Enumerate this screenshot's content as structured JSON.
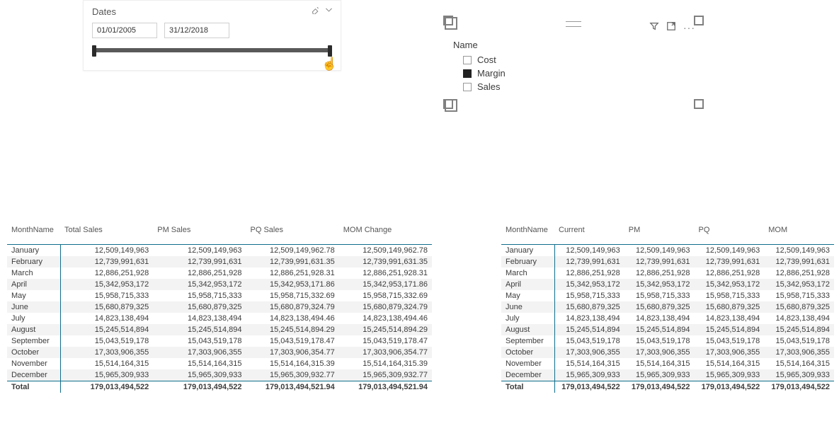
{
  "dates_slicer": {
    "title": "Dates",
    "from": "01/01/2005",
    "to": "31/12/2018"
  },
  "name_slicer": {
    "title": "Name",
    "items": [
      {
        "label": "Cost",
        "checked": false
      },
      {
        "label": "Margin",
        "checked": true
      },
      {
        "label": "Sales",
        "checked": false
      }
    ]
  },
  "table_left": {
    "headers": [
      "MonthName",
      "Total Sales",
      "PM Sales",
      "PQ Sales",
      "MOM Change"
    ],
    "rows": [
      [
        "January",
        "12,509,149,963",
        "12,509,149,963",
        "12,509,149,962.78",
        "12,509,149,962.78"
      ],
      [
        "February",
        "12,739,991,631",
        "12,739,991,631",
        "12,739,991,631.35",
        "12,739,991,631.35"
      ],
      [
        "March",
        "12,886,251,928",
        "12,886,251,928",
        "12,886,251,928.31",
        "12,886,251,928.31"
      ],
      [
        "April",
        "15,342,953,172",
        "15,342,953,172",
        "15,342,953,171.86",
        "15,342,953,171.86"
      ],
      [
        "May",
        "15,958,715,333",
        "15,958,715,333",
        "15,958,715,332.69",
        "15,958,715,332.69"
      ],
      [
        "June",
        "15,680,879,325",
        "15,680,879,325",
        "15,680,879,324.79",
        "15,680,879,324.79"
      ],
      [
        "July",
        "14,823,138,494",
        "14,823,138,494",
        "14,823,138,494.46",
        "14,823,138,494.46"
      ],
      [
        "August",
        "15,245,514,894",
        "15,245,514,894",
        "15,245,514,894.29",
        "15,245,514,894.29"
      ],
      [
        "September",
        "15,043,519,178",
        "15,043,519,178",
        "15,043,519,178.47",
        "15,043,519,178.47"
      ],
      [
        "October",
        "17,303,906,355",
        "17,303,906,355",
        "17,303,906,354.77",
        "17,303,906,354.77"
      ],
      [
        "November",
        "15,514,164,315",
        "15,514,164,315",
        "15,514,164,315.39",
        "15,514,164,315.39"
      ],
      [
        "December",
        "15,965,309,933",
        "15,965,309,933",
        "15,965,309,932.77",
        "15,965,309,932.77"
      ]
    ],
    "total": [
      "Total",
      "179,013,494,522",
      "179,013,494,522",
      "179,013,494,521.94",
      "179,013,494,521.94"
    ]
  },
  "table_right": {
    "headers": [
      "MonthName",
      "Current",
      "PM",
      "PQ",
      "MOM"
    ],
    "rows": [
      [
        "January",
        "12,509,149,963",
        "12,509,149,963",
        "12,509,149,963",
        "12,509,149,963"
      ],
      [
        "February",
        "12,739,991,631",
        "12,739,991,631",
        "12,739,991,631",
        "12,739,991,631"
      ],
      [
        "March",
        "12,886,251,928",
        "12,886,251,928",
        "12,886,251,928",
        "12,886,251,928"
      ],
      [
        "April",
        "15,342,953,172",
        "15,342,953,172",
        "15,342,953,172",
        "15,342,953,172"
      ],
      [
        "May",
        "15,958,715,333",
        "15,958,715,333",
        "15,958,715,333",
        "15,958,715,333"
      ],
      [
        "June",
        "15,680,879,325",
        "15,680,879,325",
        "15,680,879,325",
        "15,680,879,325"
      ],
      [
        "July",
        "14,823,138,494",
        "14,823,138,494",
        "14,823,138,494",
        "14,823,138,494"
      ],
      [
        "August",
        "15,245,514,894",
        "15,245,514,894",
        "15,245,514,894",
        "15,245,514,894"
      ],
      [
        "September",
        "15,043,519,178",
        "15,043,519,178",
        "15,043,519,178",
        "15,043,519,178"
      ],
      [
        "October",
        "17,303,906,355",
        "17,303,906,355",
        "17,303,906,355",
        "17,303,906,355"
      ],
      [
        "November",
        "15,514,164,315",
        "15,514,164,315",
        "15,514,164,315",
        "15,514,164,315"
      ],
      [
        "December",
        "15,965,309,933",
        "15,965,309,933",
        "15,965,309,933",
        "15,965,309,933"
      ]
    ],
    "total": [
      "Total",
      "179,013,494,522",
      "179,013,494,522",
      "179,013,494,522",
      "179,013,494,522"
    ]
  }
}
